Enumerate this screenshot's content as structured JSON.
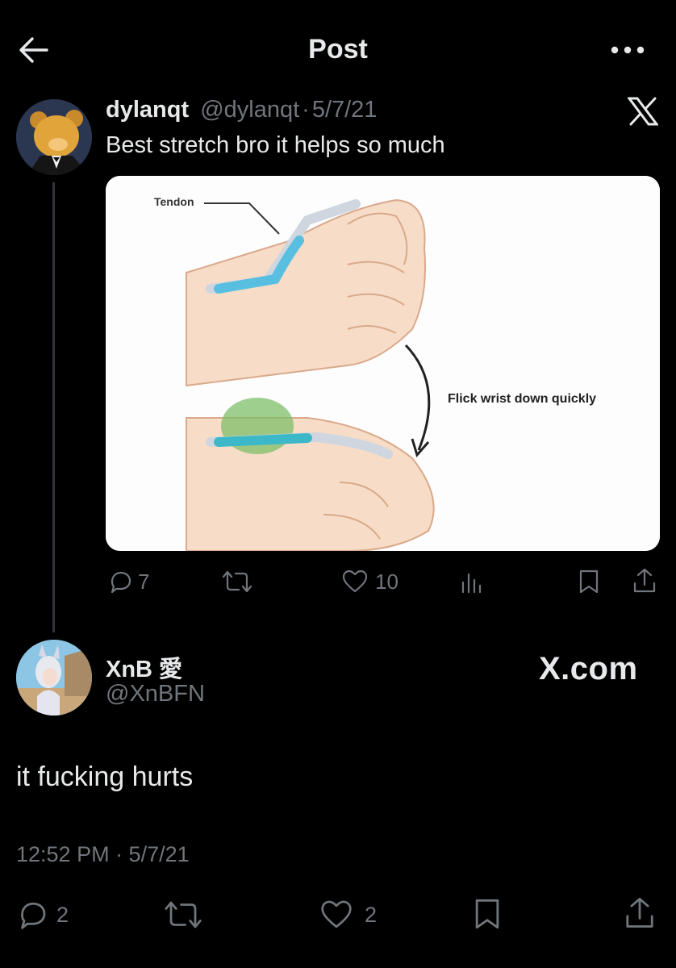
{
  "header": {
    "title": "Post",
    "back_icon": "arrow-left-icon",
    "more_icon": "more-horizontal-icon"
  },
  "quoted_post": {
    "display_name": "dylanqt",
    "handle": "@dylanqt",
    "separator": "·",
    "date": "5/7/21",
    "text": "Best stretch bro it helps so much",
    "media": {
      "label_tendon": "Tendon",
      "label_flick": "Flick wrist down quickly"
    },
    "actions": {
      "replies": "7",
      "likes": "10"
    }
  },
  "main_post": {
    "display_name": "XnB 愛",
    "handle": "@XnBFN",
    "text": "it fucking hurts",
    "timestamp": "12:52 PM · 5/7/21",
    "actions": {
      "replies": "2",
      "likes": "2"
    }
  },
  "watermark": {
    "text": "X.com"
  },
  "colors": {
    "background": "#000000",
    "text": "#e7e9ea",
    "muted": "#71767b"
  }
}
